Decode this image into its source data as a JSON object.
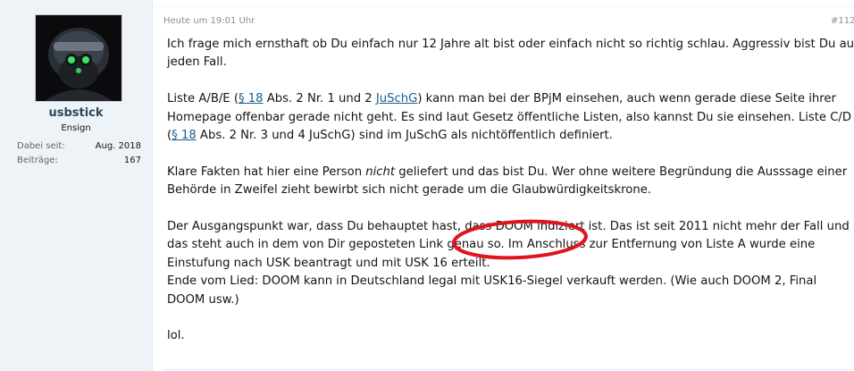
{
  "user": {
    "username": "usbstick",
    "title": "Ensign",
    "joined_label": "Dabei seit:",
    "joined_value": "Aug. 2018",
    "posts_label": "Beiträge:",
    "posts_value": "167"
  },
  "post": {
    "timestamp": "Heute um 19:01 Uhr",
    "number": "#112",
    "p1": {
      "l1": "Ich frage mich ernsthaft ob Du einfach nur 12 Jahre alt bist oder einfach nicht so richtig schlau. Aggressiv bist Du auf",
      "l2": "jeden Fall."
    },
    "p2": {
      "a": "Liste A/B/E (",
      "link1": "§ 18",
      "b": " Abs. 2 Nr. 1 und 2 ",
      "link2": "JuSchG",
      "c": ") kann man bei der BPjM einsehen, auch wenn gerade diese Seite ihrer",
      "l2": "Homepage offenbar gerade nicht geht. Es sind laut Gesetz öffentliche Listen, also kannst Du sie einsehen. Liste C/D",
      "d": "(",
      "link3": "§ 18",
      "e": " Abs. 2 Nr. 3 und 4 JuSchG) sind im JuSchG als nichtöffentlich definiert."
    },
    "p3": {
      "a": "Klare Fakten hat hier eine Person ",
      "em": "nicht",
      "b": " geliefert und das bist Du. Wer ohne weitere Begründung die Ausssage einer",
      "l2": "Behörde in Zweifel zieht bewirbt sich nicht gerade um die Glaubwürdigkeitskrone."
    },
    "p4": {
      "l1": "Der Ausgangspunkt war, dass Du behauptet hast, dass DOOM indiziert ist. Das ist seit 2011 nicht mehr der Fall und",
      "l2": "das steht auch in dem von Dir geposteten Link genau so. Im Anschluss zur Entfernung von Liste A wurde eine",
      "l3": "Einstufung nach USK beantragt und mit USK 16 erteilt.",
      "l4": "Ende vom Lied: DOOM kann in Deutschland legal mit USK16-Siegel verkauft werden. (Wie auch DOOM 2, Final",
      "l5": "DOOM usw.)"
    },
    "p5": "lol."
  },
  "colors": {
    "userpane_bg": "#eef3f8",
    "username": "#2b485c",
    "link": "#176093",
    "annotation": "#e0141e"
  },
  "icons": {
    "avatar": "avatar-soldier-night-vision"
  }
}
